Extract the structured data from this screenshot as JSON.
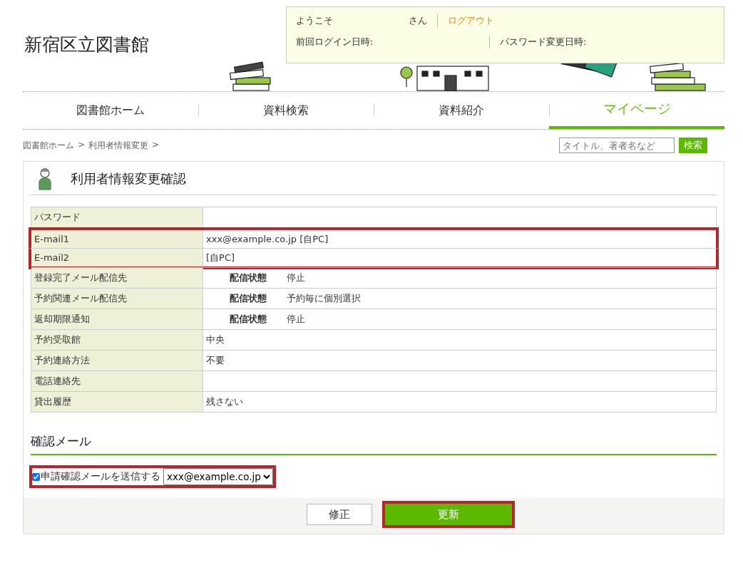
{
  "site_title": "新宿区立図書館",
  "welcome": {
    "greeting": "ようこそ",
    "honorific": "さん",
    "logout": "ログアウト",
    "last_login": "前回ログイン日時:",
    "password_changed": "パスワード変更日時:"
  },
  "nav": [
    {
      "label": "図書館ホーム",
      "selected": false
    },
    {
      "label": "資料検索",
      "selected": false
    },
    {
      "label": "資料紹介",
      "selected": false
    },
    {
      "label": "マイページ",
      "selected": true
    }
  ],
  "breadcrumb": [
    "図書館ホーム",
    "利用者情報変更"
  ],
  "breadcrumb_separator": ">",
  "search": {
    "placeholder": "タイトル、著者名など",
    "button": "検索"
  },
  "page_title": "利用者情報変更確認",
  "rows": [
    {
      "kind": "plain",
      "label": "パスワード",
      "value": null,
      "highlighted": false
    },
    {
      "kind": "plain",
      "label": "E-mail1",
      "value": "xxx@example.co.jp [自PC]",
      "highlighted": true
    },
    {
      "kind": "plain",
      "label": "E-mail2",
      "value": "[自PC]",
      "highlighted": true
    },
    {
      "kind": "status",
      "label": "登録完了メール配信先",
      "status_label": "配信状態",
      "value": "停止",
      "highlighted": false
    },
    {
      "kind": "status",
      "label": "予約関連メール配信先",
      "status_label": "配信状態",
      "value": "予約毎に個別選択",
      "highlighted": false
    },
    {
      "kind": "status",
      "label": "返却期限通知",
      "status_label": "配信状態",
      "value": "停止",
      "highlighted": false
    },
    {
      "kind": "plain",
      "label": "予約受取館",
      "value": "中央",
      "highlighted": false
    },
    {
      "kind": "plain",
      "label": "予約連絡方法",
      "value": "不要",
      "highlighted": false
    },
    {
      "kind": "plain",
      "label": "電話連絡先",
      "value": null,
      "highlighted": false
    },
    {
      "kind": "plain",
      "label": "貸出履歴",
      "value": "残さない",
      "highlighted": false
    }
  ],
  "confirm_mail": {
    "heading": "確認メール",
    "checkbox_label": "申請確認メールを送信する",
    "checked": true,
    "address": "xxx@example.co.jp",
    "highlighted": true
  },
  "buttons": [
    {
      "label": "修正",
      "kind": "secondary",
      "highlighted": false
    },
    {
      "label": "更新",
      "kind": "primary",
      "highlighted": true
    }
  ]
}
